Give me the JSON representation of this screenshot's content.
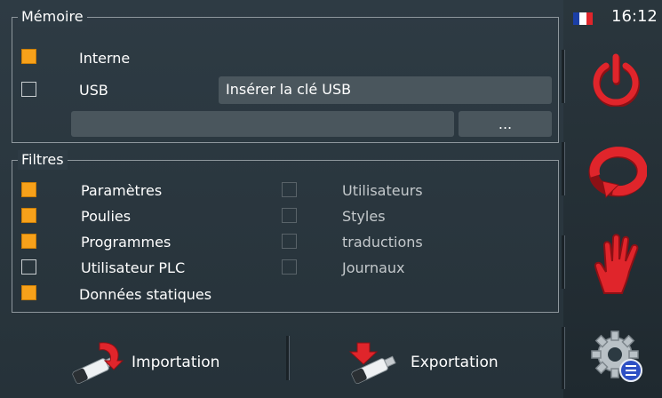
{
  "memoire": {
    "title": "Mémoire",
    "interne": {
      "label": "Interne",
      "checked": true
    },
    "usb": {
      "label": "USB",
      "checked": false
    },
    "usb_status": "Insérer la clé USB",
    "path_value": "",
    "browse_label": "..."
  },
  "filtres": {
    "title": "Filtres",
    "left": [
      {
        "label": "Paramètres",
        "checked": true
      },
      {
        "label": "Poulies",
        "checked": true
      },
      {
        "label": "Programmes",
        "checked": true
      },
      {
        "label": "Utilisateur PLC",
        "checked": false
      },
      {
        "label": "Données statiques",
        "checked": true
      }
    ],
    "right": [
      {
        "label": "Utilisateurs",
        "checked": false
      },
      {
        "label": "Styles",
        "checked": false
      },
      {
        "label": "traductions",
        "checked": false
      },
      {
        "label": "Journaux",
        "checked": false
      }
    ]
  },
  "actions": {
    "import_label": "Importation",
    "export_label": "Exportation"
  },
  "status": {
    "time": "16:12",
    "language_flag": "flag-fr-icon"
  },
  "sidebar": {
    "icons": [
      "power-icon",
      "refresh-icon",
      "hand-stop-icon",
      "settings-gear-icon"
    ]
  },
  "colors": {
    "checked": "#f7a11a",
    "power": "#e0252b",
    "background": "#2c3a42"
  }
}
